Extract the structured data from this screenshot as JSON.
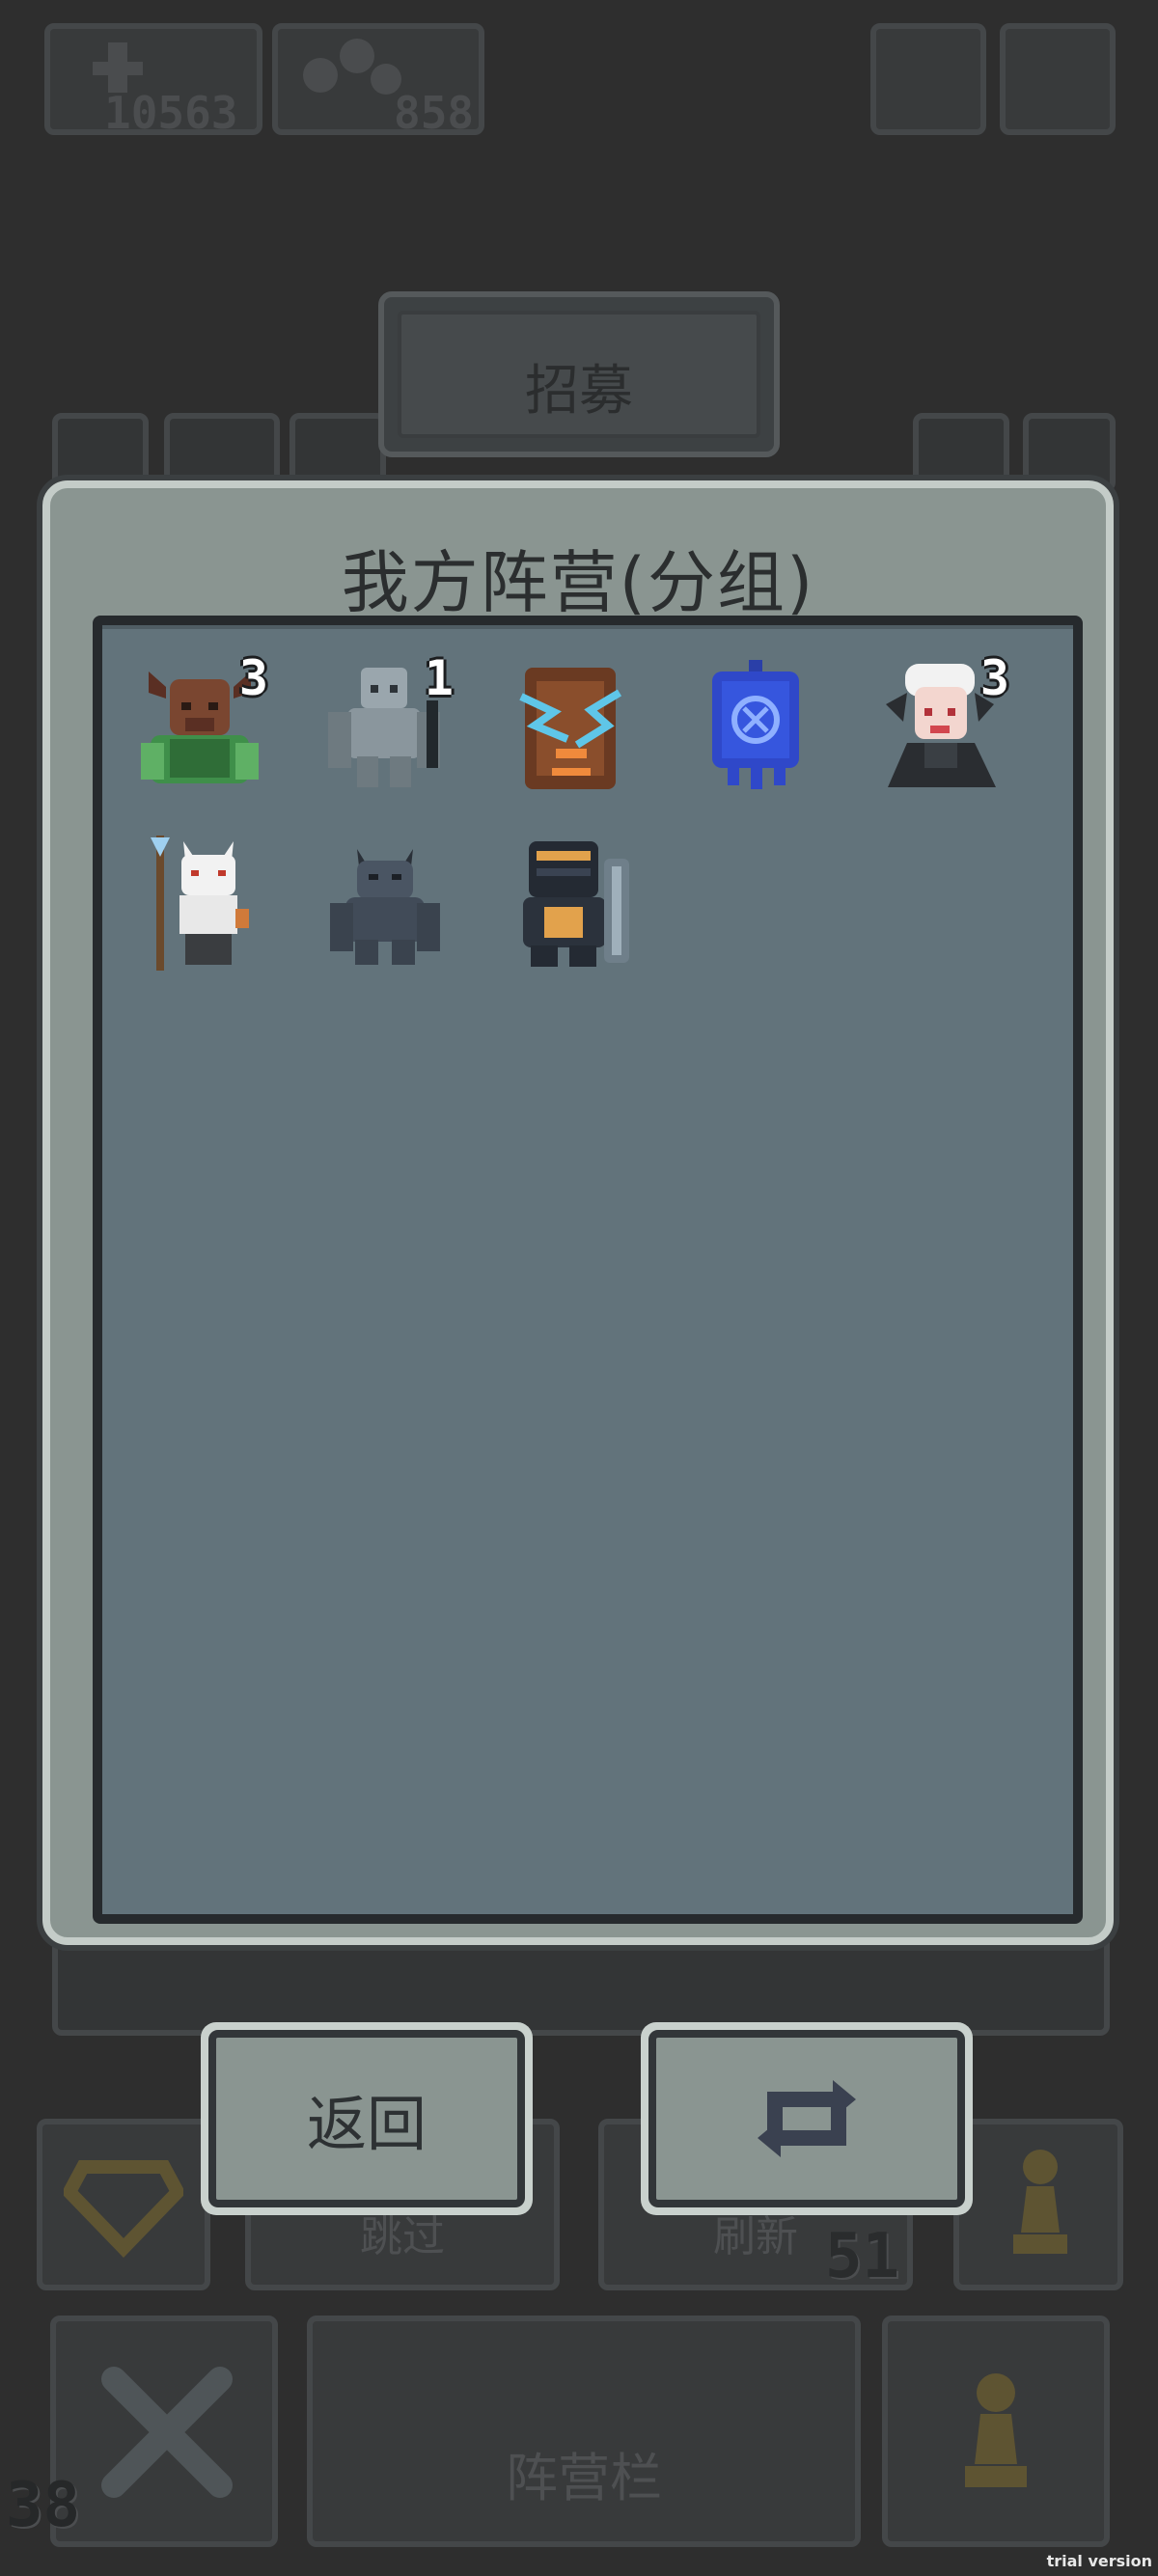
{
  "hud": {
    "population": "10563",
    "resources": "858"
  },
  "tabs": {
    "recruit_label": "招募"
  },
  "bottom_bar": {
    "skip_label": "跳过",
    "refresh_label": "刷新",
    "refresh_cost": "51",
    "camp_label": "阵营栏",
    "level": "38"
  },
  "dialog": {
    "title": "我方阵营(分组)",
    "units": [
      {
        "icon": "minotaur-icon",
        "count": "3"
      },
      {
        "icon": "stone-golem-icon",
        "count": "1"
      },
      {
        "icon": "treant-lightning-icon",
        "count": ""
      },
      {
        "icon": "rune-banner-icon",
        "count": ""
      },
      {
        "icon": "vampire-lady-icon",
        "count": "3"
      },
      {
        "icon": "fox-shaman-icon",
        "count": ""
      },
      {
        "icon": "gargoyle-icon",
        "count": ""
      },
      {
        "icon": "armored-knight-icon",
        "count": ""
      }
    ]
  },
  "buttons": {
    "back_label": "返回",
    "swap_icon": "swap-arrows-icon"
  },
  "watermark": "trial version",
  "colors": {
    "background": "#2e2e2e",
    "dialog_frame": "#8a9591",
    "inner_panel": "#62737b",
    "button_face": "#8a9591"
  }
}
